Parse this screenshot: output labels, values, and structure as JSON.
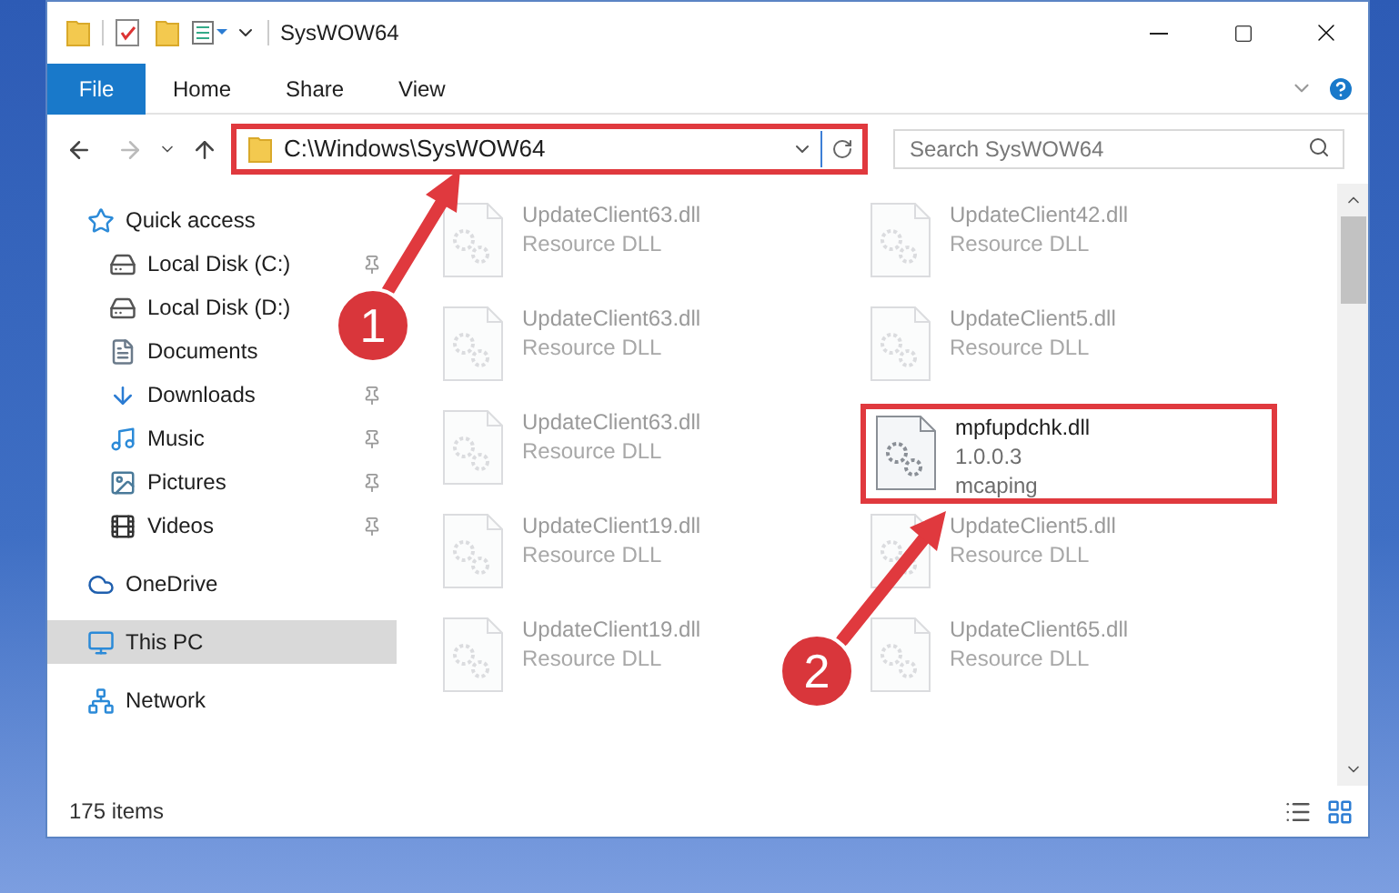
{
  "window": {
    "title": "SysWOW64"
  },
  "ribbon": {
    "tabs": [
      {
        "label": "File",
        "kind": "file"
      },
      {
        "label": "Home",
        "kind": "tab"
      },
      {
        "label": "Share",
        "kind": "tab"
      },
      {
        "label": "View",
        "kind": "tab"
      }
    ]
  },
  "address_bar": {
    "path": "C:\\Windows\\SysWOW64",
    "highlighted": true
  },
  "search": {
    "placeholder": "Search SysWOW64"
  },
  "sidebar": {
    "items": [
      {
        "label": "Quick access",
        "selected": false,
        "pinned": false,
        "children": [
          {
            "label": "Local Disk (C:)",
            "selected": false,
            "pinned": true
          },
          {
            "label": "Local Disk (D:)",
            "selected": false,
            "pinned": false
          },
          {
            "label": "Documents",
            "selected": false,
            "pinned": false
          },
          {
            "label": "Downloads",
            "selected": false,
            "pinned": true
          },
          {
            "label": "Music",
            "selected": false,
            "pinned": true
          },
          {
            "label": "Pictures",
            "selected": false,
            "pinned": true
          },
          {
            "label": "Videos",
            "selected": false,
            "pinned": true
          }
        ]
      },
      {
        "label": "OneDrive",
        "selected": false,
        "pinned": false
      },
      {
        "label": "This PC",
        "selected": true,
        "pinned": false
      },
      {
        "label": "Network",
        "selected": false,
        "pinned": false
      }
    ]
  },
  "files": [
    {
      "name": "UpdateClient63.dll",
      "details": [
        "Resource DLL"
      ],
      "blurred": true,
      "highlighted": false
    },
    {
      "name": "UpdateClient42.dll",
      "details": [
        "Resource DLL"
      ],
      "blurred": true,
      "highlighted": false
    },
    {
      "name": "UpdateClient63.dll",
      "details": [
        "Resource DLL"
      ],
      "blurred": true,
      "highlighted": false
    },
    {
      "name": "UpdateClient5.dll",
      "details": [
        "Resource DLL"
      ],
      "blurred": true,
      "highlighted": false
    },
    {
      "name": "UpdateClient63.dll",
      "details": [
        "Resource DLL"
      ],
      "blurred": true,
      "highlighted": false
    },
    {
      "name": "mpfupdchk.dll",
      "details": [
        "1.0.0.3",
        "mcaping"
      ],
      "blurred": false,
      "highlighted": true
    },
    {
      "name": "UpdateClient19.dll",
      "details": [
        "Resource DLL"
      ],
      "blurred": true,
      "highlighted": false
    },
    {
      "name": "UpdateClient5.dll",
      "details": [
        "Resource DLL"
      ],
      "blurred": true,
      "highlighted": false
    },
    {
      "name": "UpdateClient19.dll",
      "details": [
        "Resource DLL"
      ],
      "blurred": true,
      "highlighted": false
    },
    {
      "name": "UpdateClient65.dll",
      "details": [
        "Resource DLL"
      ],
      "blurred": true,
      "highlighted": false
    }
  ],
  "status_bar": {
    "text": "175 items"
  },
  "annotations": [
    {
      "label": "1"
    },
    {
      "label": "2"
    }
  ]
}
